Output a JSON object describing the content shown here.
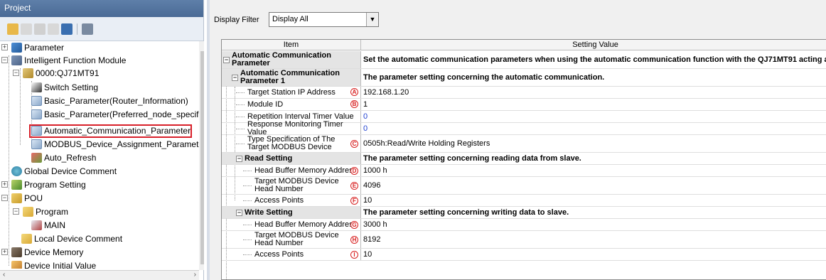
{
  "project_pane": {
    "title": "Project",
    "tree": [
      {
        "label": "Parameter",
        "icon": "parameter-icon"
      },
      {
        "label": "Intelligent Function Module",
        "icon": "module-icon"
      },
      {
        "label": "0000:QJ71MT91",
        "icon": "module-unit-icon"
      },
      {
        "label": "Switch Setting",
        "icon": "switch-setting-icon"
      },
      {
        "label": "Basic_Parameter(Router_Information)",
        "icon": "parameter-file-icon"
      },
      {
        "label": "Basic_Parameter(Preferred_node_specificati",
        "icon": "parameter-file-icon"
      },
      {
        "label": "Automatic_Communication_Parameter",
        "icon": "parameter-file-icon"
      },
      {
        "label": "MODBUS_Device_Assignment_Parameter",
        "icon": "parameter-file-icon"
      },
      {
        "label": "Auto_Refresh",
        "icon": "auto-refresh-icon"
      },
      {
        "label": "Global Device Comment",
        "icon": "globe-icon"
      },
      {
        "label": "Program Setting",
        "icon": "program-setting-icon"
      },
      {
        "label": "POU",
        "icon": "pou-icon"
      },
      {
        "label": "Program",
        "icon": "folder-icon"
      },
      {
        "label": "MAIN",
        "icon": "program-main-icon"
      },
      {
        "label": "Local Device Comment",
        "icon": "folder-icon"
      },
      {
        "label": "Device Memory",
        "icon": "device-memory-icon"
      },
      {
        "label": "Device Initial Value",
        "icon": "device-initial-icon"
      }
    ]
  },
  "filter": {
    "label": "Display Filter",
    "value": "Display All"
  },
  "grid": {
    "headers": {
      "item": "Item",
      "value": "Setting Value"
    },
    "rows": [
      {
        "item": "Automatic Communication Parameter",
        "value": "Set the automatic communication parameters when using the automatic communication function with the QJ71MT91 acting as the mast",
        "group": true
      },
      {
        "item": "Automatic Communication Parameter 1",
        "value": "The parameter setting concerning the automatic communication.",
        "group": true
      },
      {
        "item": "Target Station IP Address",
        "value": "192.168.1.20",
        "marker": "A"
      },
      {
        "item": "Module ID",
        "value": "1",
        "marker": "B"
      },
      {
        "item": "Repetition Interval Timer Value",
        "value": "0",
        "blue": true
      },
      {
        "item": "Response Monitoring Timer Value",
        "value": "0",
        "blue": true
      },
      {
        "item": "Type Specification of The Target MODBUS Device",
        "value": "0505h:Read/Write Holding Registers",
        "marker": "C"
      },
      {
        "item": "Read Setting",
        "value": "The parameter setting concerning reading data from slave.",
        "group": true
      },
      {
        "item": "Head Buffer Memory Address",
        "value": "1000 h",
        "marker": "D"
      },
      {
        "item": "Target MODBUS Device Head Number",
        "value": "4096",
        "marker": "E"
      },
      {
        "item": "Access Points",
        "value": "10",
        "marker": "F"
      },
      {
        "item": "Write Setting",
        "value": "The parameter setting concerning writing data to slave.",
        "group": true
      },
      {
        "item": "Head Buffer Memory Address",
        "value": "3000 h",
        "marker": "G"
      },
      {
        "item": "Target MODBUS Device Head Number",
        "value": "8192",
        "marker": "H"
      },
      {
        "item": "Access Points",
        "value": "10",
        "marker": "I"
      }
    ]
  }
}
